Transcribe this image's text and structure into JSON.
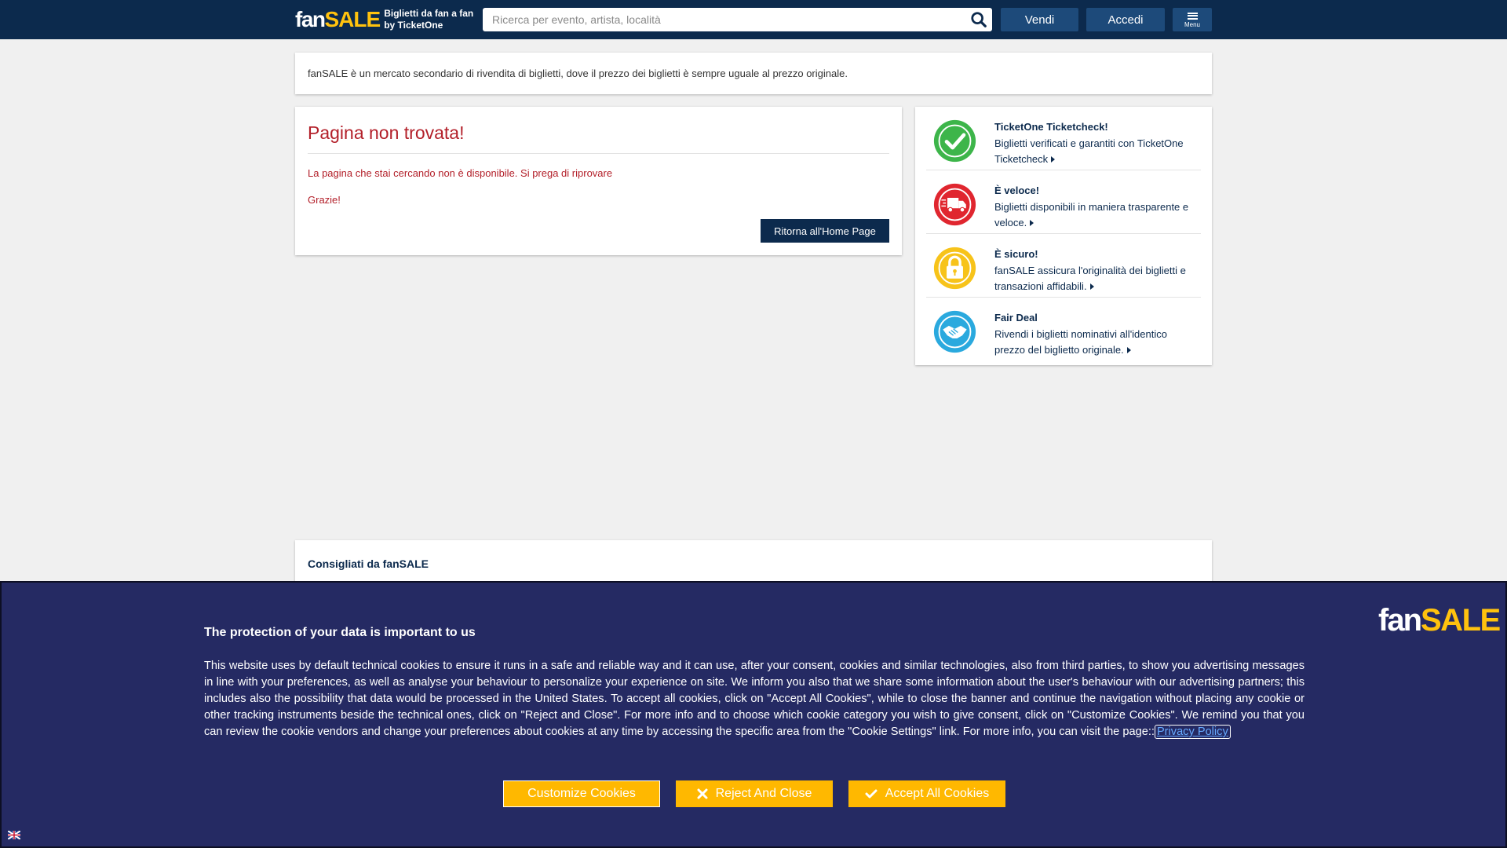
{
  "header": {
    "logo_fan": "fan",
    "logo_sale": "SALE",
    "tagline_1": "Biglietti da fan a fan",
    "tagline_2": "by TicketOne",
    "search_placeholder": "Ricerca per evento, artista, località",
    "sell_label": "Vendi",
    "login_label": "Accedi",
    "menu_label": "Menu"
  },
  "info_bar": {
    "text": "fanSALE è un mercato secondario di rivendita di biglietti, dove il prezzo dei biglietti è sempre uguale al prezzo originale."
  },
  "not_found": {
    "title": "Pagina non trovata!",
    "message": "La pagina che stai cercando non è disponibile. Si prega di riprovare",
    "thanks": "Grazie!",
    "home_button": "Ritorna all'Home Page"
  },
  "features": [
    {
      "title": "TicketOne Ticketcheck!",
      "desc": "Biglietti verificati e garantiti con TicketOne Ticketcheck",
      "icon": "checkmark-icon",
      "color": "#3db54a"
    },
    {
      "title": "È veloce!",
      "desc": "Biglietti disponibili in maniera trasparente e veloce.",
      "icon": "delivery-truck-icon",
      "color": "#e0262f"
    },
    {
      "title": "È sicuro!",
      "desc": "fanSALE assicura l'originalità dei biglietti e transazioni affidabili.",
      "icon": "padlock-icon",
      "color": "#f7c31a"
    },
    {
      "title": "Fair Deal",
      "desc": "Rivendi i biglietti nominativi all'identico prezzo del biglietto originale.",
      "icon": "handshake-icon",
      "color": "#2aa9de"
    }
  ],
  "recommended": {
    "title": "Consigliati da fanSALE"
  },
  "cookie_banner": {
    "logo_fan": "fan",
    "logo_sale": "SALE",
    "title": "The protection of your data is important to us",
    "text": "This website uses by default technical cookies to ensure it runs in a safe and reliable way and it can use, after your consent, cookies and similar technologies, also from third parties, to show you advertising messages in line with your preferences, as well as analyse your behaviour to personalize your experience on site. We inform you also that we share some information about the user's behaviour with our advertising partners; this includes also the possibility that data would be processed in the United States. To accept all cookies, click on \"Accept All Cookies\", while to close the banner and continue the navigation without placing any cookie or other tracking instruments beside the technical ones, click on \"Reject and Close\". For more info and to choose which cookie category you wish to give consent, click on \"Customize Cookies\". We remind you that you can review the cookie vendors and change your preferences about cookies at any time by accessing the specific area from the \"Cookie Settings\" link. For more info, you can visit the page::",
    "privacy_link": "Privacy Policy",
    "customize_label": "Customize Cookies",
    "reject_label": "Reject And Close",
    "accept_label": "Accept All Cookies"
  },
  "colors": {
    "header_bg": "#0c2a4d",
    "brand_yellow": "#ffc20e",
    "error_red": "#b3202a",
    "banner_bg": "#252a63",
    "cookie_button": "#ffb800"
  }
}
